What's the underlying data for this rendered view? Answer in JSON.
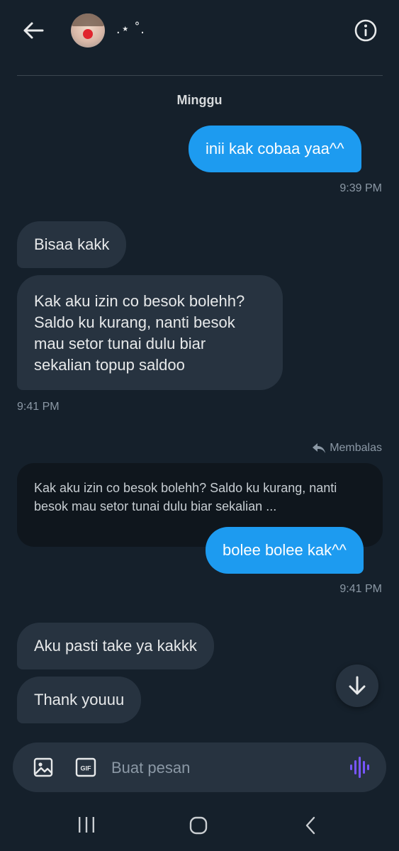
{
  "header": {
    "display_name": ".⋆ ˚.",
    "back_icon": "arrow-left-icon",
    "info_icon": "info-circle-icon"
  },
  "conversation": {
    "day_label": "Minggu",
    "messages": [
      {
        "text": "inii kak cobaa yaa^^",
        "time": "9:39 PM"
      },
      {
        "text": "Bisaa kakk"
      },
      {
        "text": "Kak aku izin co besok bolehh? Saldo ku kurang, nanti besok mau setor tunai dulu biar sekalian topup saldoo",
        "time": "9:41 PM"
      },
      {
        "reply_label": "Membalas",
        "quoted": "Kak aku izin co besok bolehh? Saldo ku kurang, nanti besok mau setor tunai dulu biar sekalian ...",
        "text": "bolee bolee kak^^",
        "time": "9:41 PM"
      },
      {
        "text": "Aku pasti take ya kakkk"
      },
      {
        "text": "Thank youuu"
      }
    ]
  },
  "composer": {
    "placeholder": "Buat pesan",
    "gif_label": "GIF"
  },
  "colors": {
    "background": "#15202b",
    "outgoing_bubble": "#1d9bf0",
    "incoming_bubble": "#273340",
    "accent_voice": "#7856ff"
  }
}
